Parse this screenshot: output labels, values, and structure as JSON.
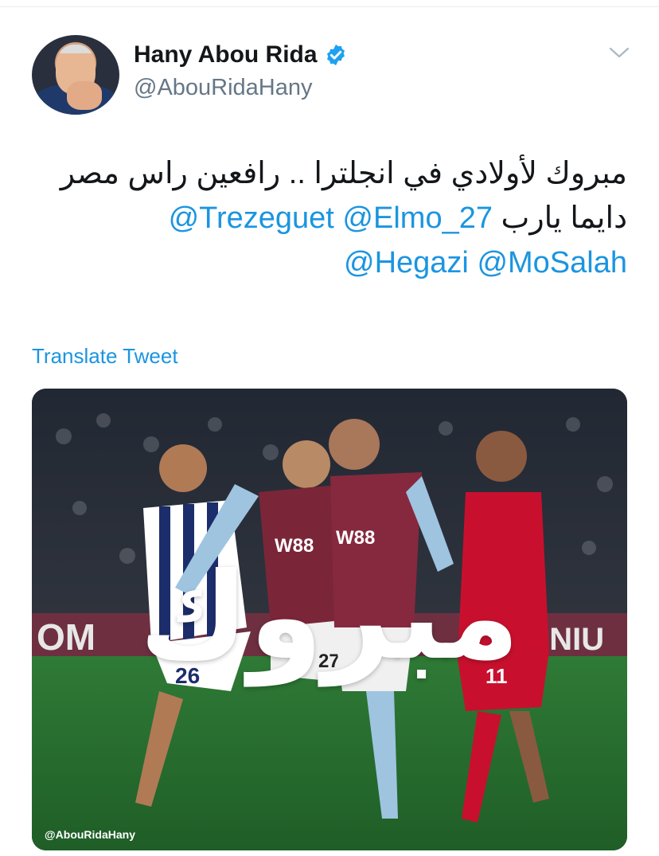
{
  "user": {
    "name": "Hany Abou Rida",
    "handle": "@AbouRidaHany",
    "verified_icon": "verified-badge-icon",
    "avatar": "profile-avatar"
  },
  "menu": {
    "icon": "chevron-down-icon"
  },
  "tweet": {
    "line1": "مبروك لأولادي في انجلترا .. رافعين راس مصر",
    "line2_text": "دايما يارب",
    "mentions": [
      "@Elmo_27",
      "@Trezeguet",
      "@MoSalah",
      "@Hegazi"
    ]
  },
  "translate_label": "Translate Tweet",
  "media": {
    "overlay_text": "مبروك",
    "watermark": "@AbouRidaHany",
    "ad_board_text": "OM",
    "ad_board_text_right": "3NIU",
    "sponsor_text": "W88",
    "jersey_numbers": [
      "26",
      "27",
      "11"
    ]
  },
  "colors": {
    "link": "#1b95e0",
    "text": "#14171a",
    "secondary": "#657786",
    "verified": "#1da1f2"
  }
}
